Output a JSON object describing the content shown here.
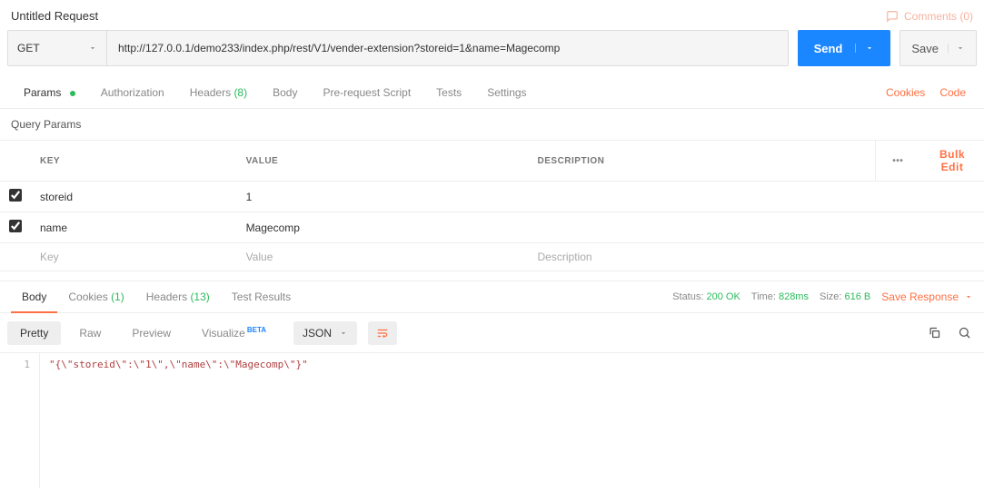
{
  "header": {
    "title": "Untitled Request",
    "comments_label": "Comments (0)"
  },
  "request": {
    "method": "GET",
    "url": "http://127.0.0.1/demo233/index.php/rest/V1/vender-extension?storeid=1&name=Magecomp",
    "send_label": "Send",
    "save_label": "Save"
  },
  "req_tabs": {
    "params": "Params",
    "authorization": "Authorization",
    "headers": "Headers",
    "headers_count": "(8)",
    "body": "Body",
    "prerequest": "Pre-request Script",
    "tests": "Tests",
    "settings": "Settings",
    "cookies": "Cookies",
    "code": "Code"
  },
  "query": {
    "section_label": "Query Params",
    "col_key": "KEY",
    "col_value": "VALUE",
    "col_desc": "DESCRIPTION",
    "bulk_edit": "Bulk Edit",
    "rows": [
      {
        "enabled": true,
        "key": "storeid",
        "value": "1",
        "desc": ""
      },
      {
        "enabled": true,
        "key": "name",
        "value": "Magecomp",
        "desc": ""
      }
    ],
    "placeholder_key": "Key",
    "placeholder_value": "Value",
    "placeholder_desc": "Description"
  },
  "resp_tabs": {
    "body": "Body",
    "cookies": "Cookies",
    "cookies_count": "(1)",
    "headers": "Headers",
    "headers_count": "(13)",
    "tests": "Test Results"
  },
  "meta": {
    "status_label": "Status:",
    "status_value": "200 OK",
    "time_label": "Time:",
    "time_value": "828ms",
    "size_label": "Size:",
    "size_value": "616 B",
    "save_response": "Save Response"
  },
  "viewer": {
    "pretty": "Pretty",
    "raw": "Raw",
    "preview": "Preview",
    "visualize": "Visualize",
    "visualize_badge": "BETA",
    "format": "JSON"
  },
  "response_body": {
    "line_num": "1",
    "content": "\"{\\\"storeid\\\":\\\"1\\\",\\\"name\\\":\\\"Magecomp\\\"}\""
  }
}
